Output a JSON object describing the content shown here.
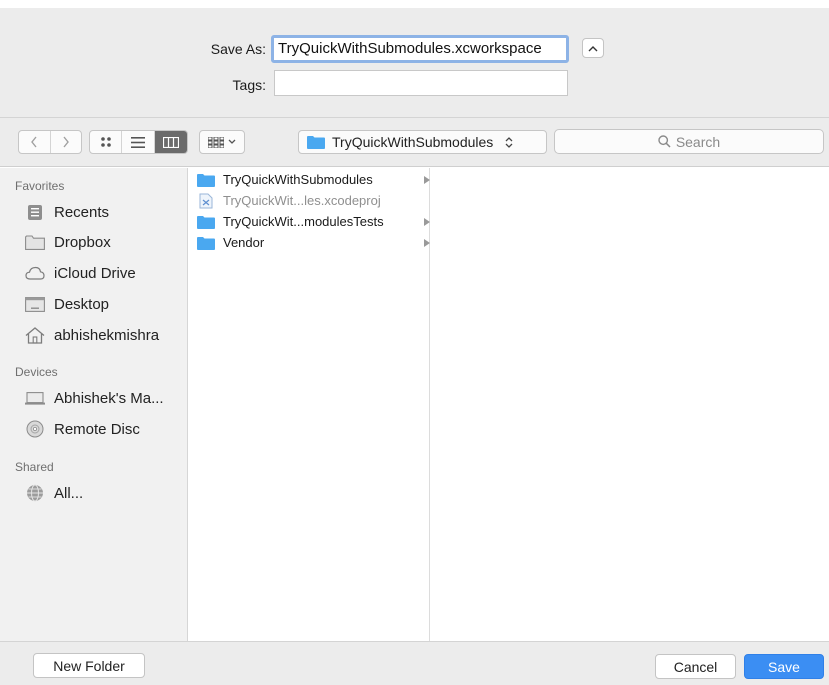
{
  "save_as": {
    "label": "Save As:",
    "value": "TryQuickWithSubmodules.xcworkspace"
  },
  "tags": {
    "label": "Tags:",
    "value": ""
  },
  "toolbar": {
    "path_popup": "TryQuickWithSubmodules",
    "search_placeholder": "Search"
  },
  "sidebar": {
    "favorites_title": "Favorites",
    "favorites": [
      {
        "label": "Recents",
        "icon": "recents-icon"
      },
      {
        "label": "Dropbox",
        "icon": "folder-icon"
      },
      {
        "label": "iCloud Drive",
        "icon": "cloud-icon"
      },
      {
        "label": "Desktop",
        "icon": "desktop-icon"
      },
      {
        "label": "abhishekmishra",
        "icon": "home-icon"
      }
    ],
    "devices_title": "Devices",
    "devices": [
      {
        "label": "Abhishek's Ma...",
        "icon": "laptop-icon"
      },
      {
        "label": "Remote Disc",
        "icon": "disc-icon"
      }
    ],
    "shared_title": "Shared",
    "shared": [
      {
        "label": "All...",
        "icon": "network-icon"
      }
    ]
  },
  "files": [
    {
      "name": "TryQuickWithSubmodules",
      "type": "folder",
      "has_children": true,
      "dimmed": false
    },
    {
      "name": "TryQuickWit...les.xcodeproj",
      "type": "xcodeproj",
      "has_children": false,
      "dimmed": true
    },
    {
      "name": "TryQuickWit...modulesTests",
      "type": "folder",
      "has_children": true,
      "dimmed": false
    },
    {
      "name": "Vendor",
      "type": "folder",
      "has_children": true,
      "dimmed": false
    }
  ],
  "buttons": {
    "new_folder": "New Folder",
    "cancel": "Cancel",
    "save": "Save"
  },
  "colors": {
    "accent": "#3b8ef3",
    "folder": "#4aa8f0",
    "focus_ring": "#8db3e6"
  }
}
